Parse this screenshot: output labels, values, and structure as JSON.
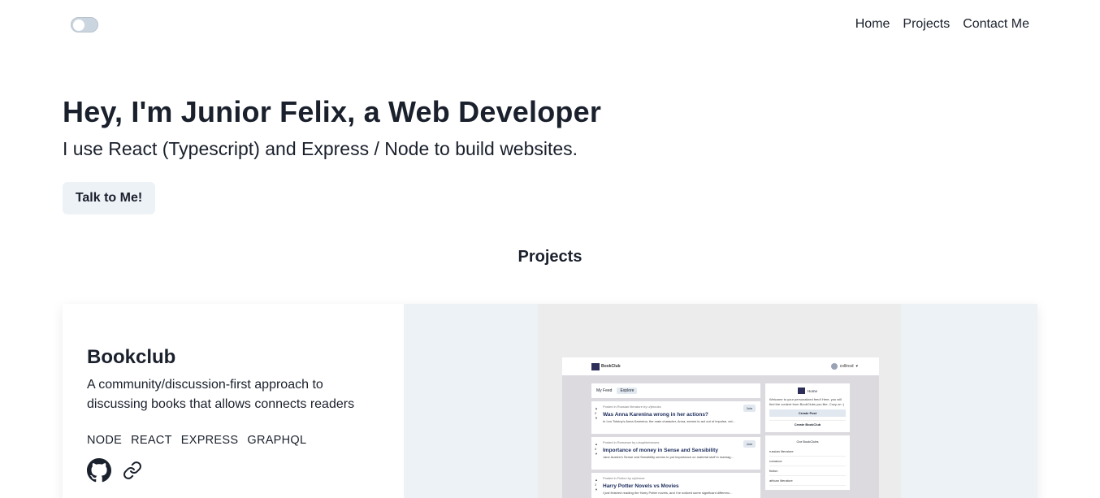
{
  "nav": {
    "items": [
      {
        "label": "Home"
      },
      {
        "label": "Projects"
      },
      {
        "label": "Contact Me"
      }
    ]
  },
  "theme_toggle": {
    "state": "off"
  },
  "hero": {
    "title": "Hey, I'm Junior Felix, a Web Developer",
    "subtitle": "I use React (Typescript) and Express / Node to build websites.",
    "cta_label": "Talk to Me!"
  },
  "projects": {
    "heading": "Projects",
    "items": [
      {
        "title": "Bookclub",
        "description": "A community/discussion-first approach to discussing books that allows connects readers",
        "tags": [
          "NODE",
          "REACT",
          "EXPRESS",
          "GRAPHQL"
        ],
        "links": [
          {
            "icon": "github-icon"
          },
          {
            "icon": "link-icon"
          }
        ],
        "screenshot": {
          "brand": "BookClub",
          "user": "collinsd",
          "tabs": [
            "My Feed",
            "Explore"
          ],
          "posts": [
            {
              "meta": "Posted in Russian literature by u/jbrooks",
              "title": "Was Anna Karenina wrong in her actions?",
              "snippet": "In Leo Tolstoy's Anna Karenina, the main character, Anna, seems to act out of impulse, ext...",
              "votes": "5",
              "action": "Join"
            },
            {
              "meta": "Posted in Romance by u/sophiebrowns",
              "title": "Importance of money in Sense and Sensibility",
              "snippet": "Jane Austen's Sense and Sensibility seems to put importance on material stuff in marriag...",
              "votes": "8",
              "action": "Join"
            },
            {
              "meta": "Posted in Fiction by u/jdrmoe",
              "title": "Harry Potter Novels vs Movies",
              "snippet": "I just finished reading the Harry Potter novels, and I've noticed some significant differenc...",
              "votes": "3",
              "action": ""
            }
          ],
          "side": {
            "home_label": "Home",
            "welcome": "Welcome to your personalized feed! Here, you will find the content from BookClubs you like. Cozy on :)",
            "create_post": "Create Post",
            "create_club": "Create BookClub",
            "list_title": "Our BookClubs",
            "clubs": [
              "russian literature",
              "romance",
              "fiction",
              "african literature"
            ]
          }
        }
      }
    ]
  }
}
